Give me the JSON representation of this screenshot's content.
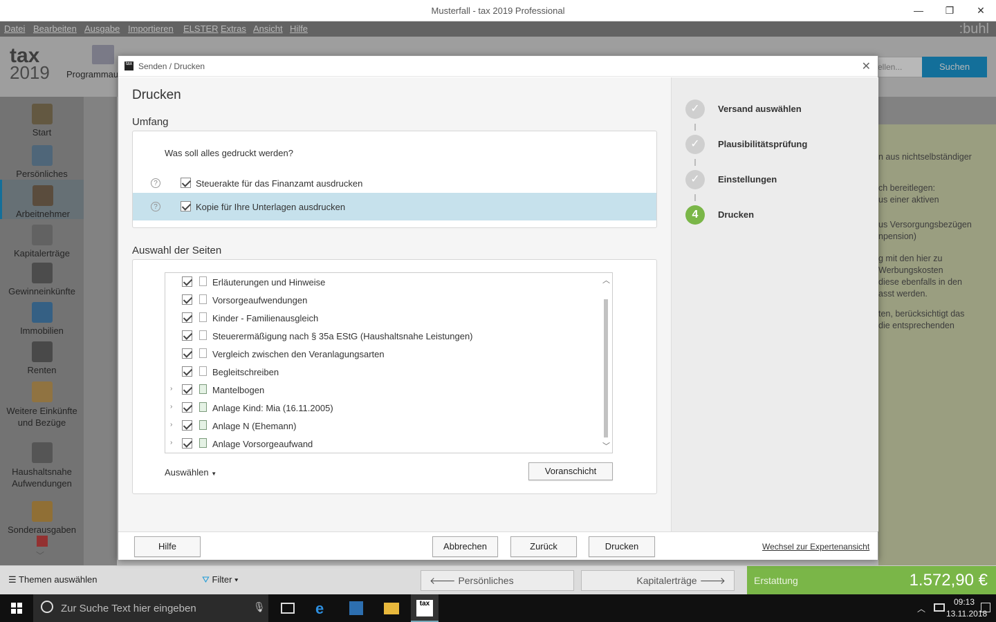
{
  "window": {
    "title": "Musterfall - tax 2019 Professional",
    "minimize": "—",
    "maximize": "❐",
    "close": "✕"
  },
  "menu": {
    "items": [
      "Datei",
      "Bearbeiten",
      "Ausgabe",
      "Importieren",
      "ELSTER",
      "Extras",
      "Ansicht",
      "Hilfe"
    ],
    "brand": ":buhl"
  },
  "toolbar": {
    "logo_line1": "tax",
    "logo_line2": "2019",
    "program_label": "Programmau",
    "search_placeholder": "ellen...",
    "search_button": "Suchen"
  },
  "sidebar": {
    "items": [
      {
        "label": "Start"
      },
      {
        "label": "Persönliches"
      },
      {
        "label": "Arbeitnehmer"
      },
      {
        "label": "Kapitalerträge"
      },
      {
        "label": "Gewinneinkünfte"
      },
      {
        "label": "Immobilien"
      },
      {
        "label": "Renten"
      },
      {
        "label": "Weitere Einkünfte und Bezüge"
      },
      {
        "label": "Haushaltsnahe Aufwendungen"
      },
      {
        "label": "Sonderausgaben"
      }
    ]
  },
  "right_text": [
    "n aus nichtselbständiger",
    "ch bereitlegen:",
    "us einer aktiven",
    "us Versorgungsbezügen",
    "npension)",
    "g mit den hier zu",
    "Werbungskosten",
    "diese ebenfalls in den",
    "asst werden.",
    "ten, berücksichtigt das",
    "die entsprechenden"
  ],
  "bottom": {
    "themes": "Themen auswählen",
    "filter": "Filter",
    "prev": "Persönliches",
    "next": "Kapitalerträge",
    "refund_label": "Erstattung",
    "refund_value": "1.572,90 €"
  },
  "taskbar": {
    "search": "Zur Suche Text hier eingeben",
    "time": "09:13",
    "date": "13.11.2018"
  },
  "dialog": {
    "title": "Senden / Drucken",
    "heading": "Drucken",
    "scope": {
      "title": "Umfang",
      "question": "Was soll alles gedruckt werden?",
      "options": [
        {
          "label": "Steuerakte für das Finanzamt ausdrucken",
          "checked": true
        },
        {
          "label": "Kopie für Ihre Unterlagen ausdrucken",
          "checked": true
        }
      ]
    },
    "pages": {
      "title": "Auswahl der Seiten",
      "items": [
        {
          "label": "Erläuterungen und Hinweise",
          "expandable": false
        },
        {
          "label": "Vorsorgeaufwendungen",
          "expandable": false
        },
        {
          "label": "Kinder - Familienausgleich",
          "expandable": false
        },
        {
          "label": "Steuerermäßigung nach § 35a EStG (Haushaltsnahe Leistungen)",
          "expandable": false
        },
        {
          "label": "Vergleich zwischen den Veranlagungsarten",
          "expandable": false
        },
        {
          "label": "Begleitschreiben",
          "expandable": false
        },
        {
          "label": "Mantelbogen",
          "expandable": true
        },
        {
          "label": "Anlage Kind: Mia (16.11.2005)",
          "expandable": true
        },
        {
          "label": "Anlage N (Ehemann)",
          "expandable": true
        },
        {
          "label": "Anlage Vorsorgeaufwand",
          "expandable": true
        }
      ],
      "select_label": "Auswählen",
      "preview_button": "Voranschicht"
    },
    "steps": [
      {
        "label": "Versand auswählen",
        "done": true
      },
      {
        "label": "Plausibilitätsprüfung",
        "done": true
      },
      {
        "label": "Einstellungen",
        "done": true
      },
      {
        "label": "Drucken",
        "number": "4",
        "current": true
      }
    ],
    "footer": {
      "help": "Hilfe",
      "cancel": "Abbrechen",
      "back": "Zurück",
      "print": "Drucken",
      "expert": "Wechsel zur Expertenansicht"
    }
  }
}
